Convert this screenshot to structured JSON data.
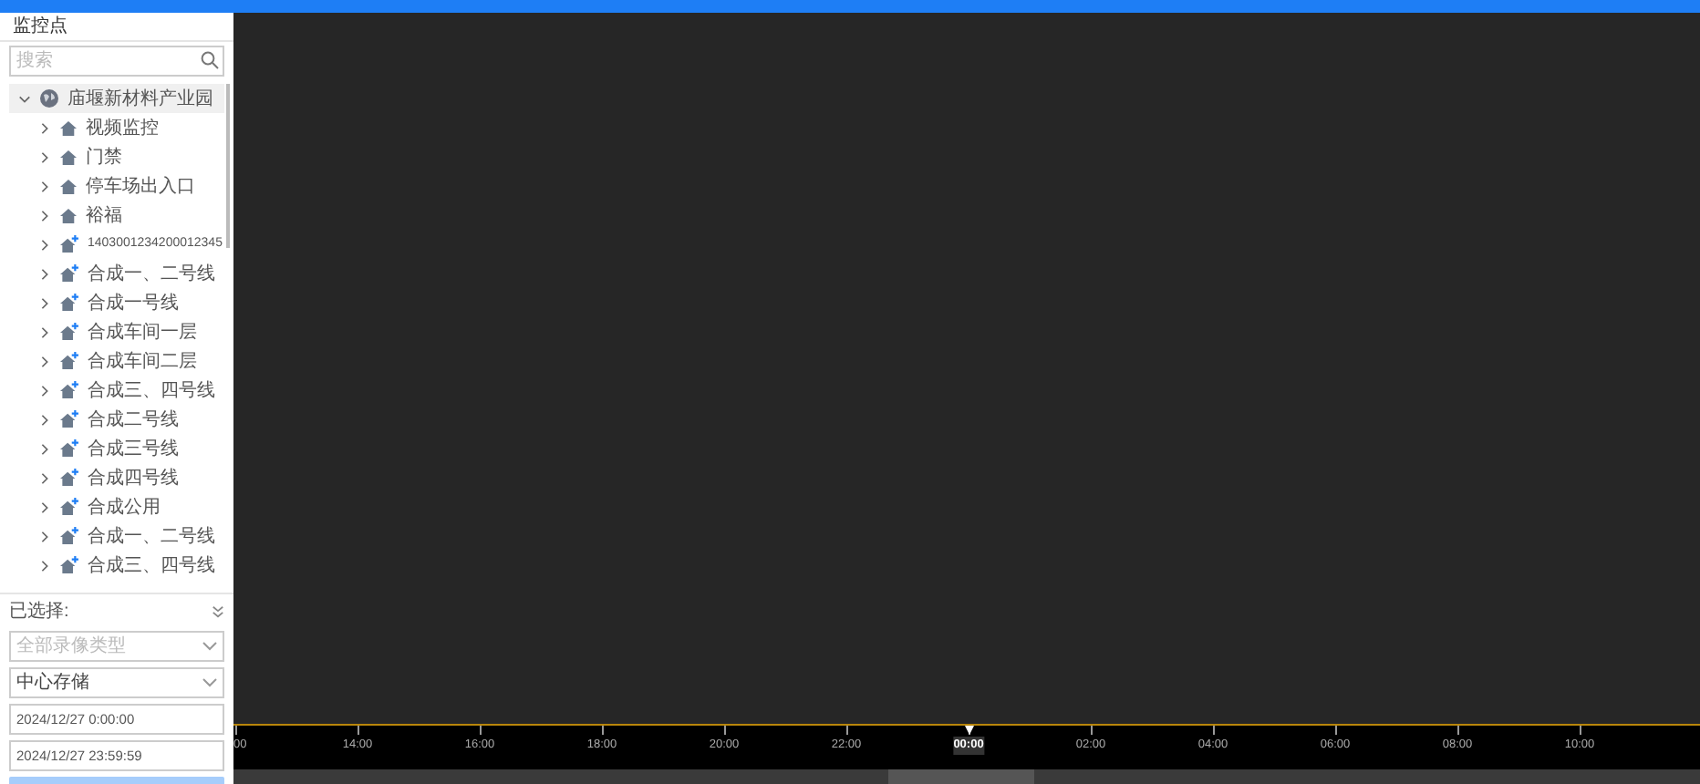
{
  "panel": {
    "title": "监控点",
    "search": {
      "placeholder": "搜索"
    },
    "tree": [
      {
        "label": "庙堰新材料产业园",
        "kind": "root",
        "expanded": true,
        "children": [
          {
            "label": "视频监控",
            "kind": "site",
            "expanded": false
          },
          {
            "label": "门禁",
            "kind": "site",
            "expanded": false
          },
          {
            "label": "停车场出入口",
            "kind": "site",
            "expanded": false
          },
          {
            "label": "裕福",
            "kind": "site",
            "expanded": false
          },
          {
            "label": "1403001234200012345",
            "kind": "line",
            "expanded": false
          },
          {
            "label": "合成一、二号线",
            "kind": "line",
            "expanded": false
          },
          {
            "label": "合成一号线",
            "kind": "line",
            "expanded": false
          },
          {
            "label": "合成车间一层",
            "kind": "line",
            "expanded": false
          },
          {
            "label": "合成车间二层",
            "kind": "line",
            "expanded": false
          },
          {
            "label": "合成三、四号线",
            "kind": "line",
            "expanded": false
          },
          {
            "label": "合成二号线",
            "kind": "line",
            "expanded": false
          },
          {
            "label": "合成三号线",
            "kind": "line",
            "expanded": false
          },
          {
            "label": "合成四号线",
            "kind": "line",
            "expanded": false
          },
          {
            "label": "合成公用",
            "kind": "line",
            "expanded": false
          },
          {
            "label": "合成一、二号线",
            "kind": "line",
            "expanded": false
          },
          {
            "label": "合成三、四号线",
            "kind": "line",
            "expanded": false
          }
        ]
      }
    ],
    "selected_label": "已选择:",
    "record_type": {
      "placeholder": "全部录像类型"
    },
    "storage": {
      "value": "中心存储"
    },
    "start_time": {
      "value": "2024/12/27 0:00:00"
    },
    "end_time": {
      "value": "2024/12/27 23:59:59"
    }
  },
  "timeline": {
    "ticks": [
      {
        "label": "00",
        "kind": "cut",
        "cursor": false
      },
      {
        "label": "14:00",
        "kind": "full",
        "cursor": false
      },
      {
        "label": "16:00",
        "kind": "full",
        "cursor": false
      },
      {
        "label": "18:00",
        "kind": "full",
        "cursor": false
      },
      {
        "label": "20:00",
        "kind": "full",
        "cursor": false
      },
      {
        "label": "22:00",
        "kind": "full",
        "cursor": false
      },
      {
        "label": "00:00",
        "kind": "full",
        "cursor": true
      },
      {
        "label": "02:00",
        "kind": "full",
        "cursor": false
      },
      {
        "label": "04:00",
        "kind": "full",
        "cursor": false
      },
      {
        "label": "06:00",
        "kind": "full",
        "cursor": false
      },
      {
        "label": "08:00",
        "kind": "full",
        "cursor": false
      },
      {
        "label": "10:00",
        "kind": "full",
        "cursor": false
      }
    ]
  }
}
